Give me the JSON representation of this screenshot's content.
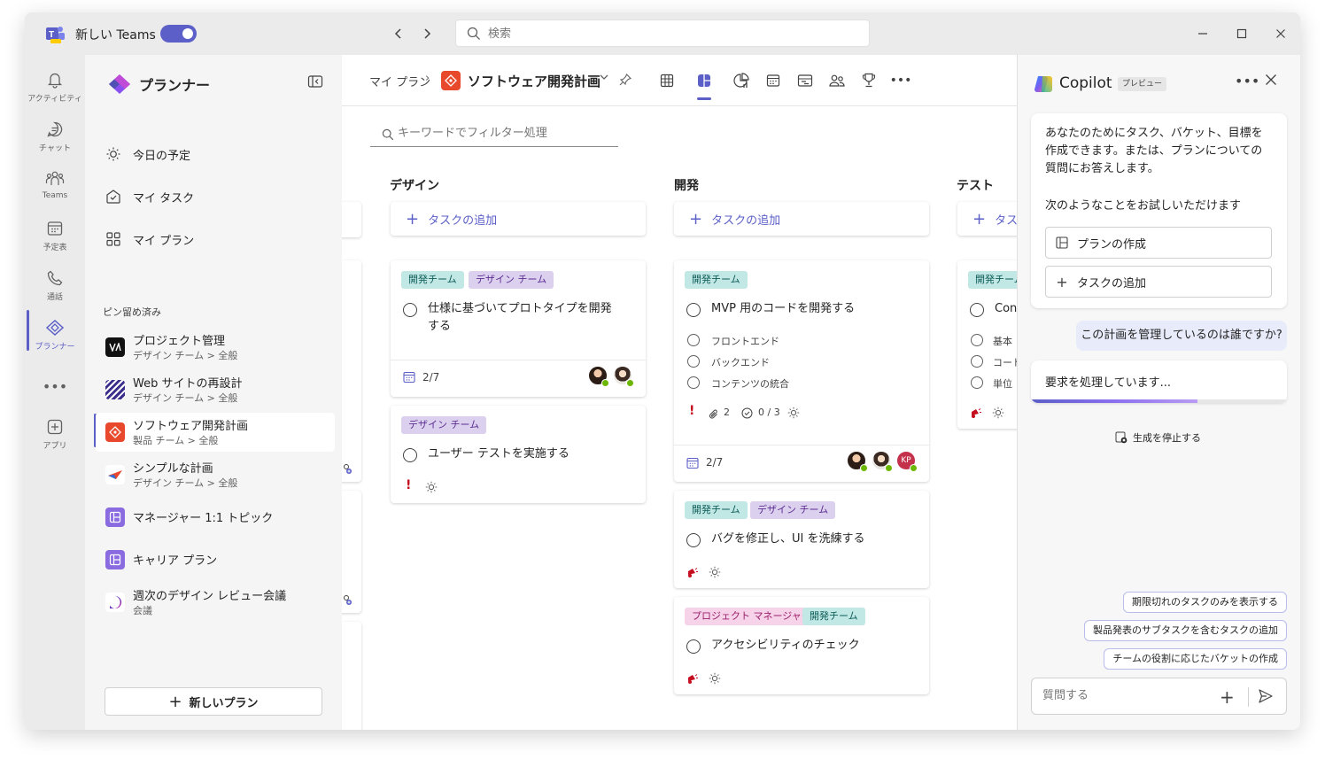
{
  "titlebar": {
    "app_title": "新しい Teams",
    "search_placeholder": "検索"
  },
  "rail": {
    "items": [
      {
        "label": "アクティビティ",
        "icon": "bell-icon"
      },
      {
        "label": "チャット",
        "icon": "chat-icon"
      },
      {
        "label": "Teams",
        "icon": "teams-icon"
      },
      {
        "label": "予定表",
        "icon": "calendar-icon"
      },
      {
        "label": "通話",
        "icon": "phone-icon"
      },
      {
        "label": "プランナー",
        "icon": "planner-icon"
      },
      {
        "label": "アプリ",
        "icon": "apps-icon"
      }
    ]
  },
  "sidebar": {
    "title": "プランナー",
    "nav": [
      {
        "label": "今日の予定",
        "icon": "sun-icon"
      },
      {
        "label": "マイ タスク",
        "icon": "my-tasks-icon"
      },
      {
        "label": "マイ プラン",
        "icon": "grid-icon"
      }
    ],
    "pinned_header": "ピン留め済み",
    "pinned": [
      {
        "title": "プロジェクト管理",
        "subtitle": "デザイン チーム > 全般"
      },
      {
        "title": "Web サイトの再設計",
        "subtitle": "デザイン チーム > 全般"
      },
      {
        "title": "ソフトウェア開発計画",
        "subtitle": "製品 チーム > 全般"
      },
      {
        "title": "シンプルな計画",
        "subtitle": "デザイン チーム > 全般"
      },
      {
        "title": "マネージャー 1:1 トピック",
        "subtitle": ""
      },
      {
        "title": "キャリア プラン",
        "subtitle": ""
      },
      {
        "title": "週次のデザイン レビュー会議",
        "subtitle": "会議"
      }
    ],
    "new_plan_label": "新しいプラン"
  },
  "main": {
    "breadcrumb_root": "マイ プラン",
    "plan_title": "ソフトウェア開発計画",
    "filter_placeholder": "キーワードでフィルター処理",
    "add_task_label": "タスクの追加",
    "buckets": [
      {
        "title": "デザイン",
        "cards": [
          {
            "tags": [
              "開発チーム",
              "デザイン チーム"
            ],
            "title": [
              "仕様に基づいてプロトタイプを開発",
              "する"
            ],
            "date": "2/7"
          },
          {
            "tags": [
              "デザイン チーム"
            ],
            "title": [
              "ユーザー テストを実施する"
            ]
          }
        ]
      },
      {
        "title": "開発",
        "cards": [
          {
            "tags": [
              "開発チーム"
            ],
            "title": [
              "MVP 用のコードを開発する"
            ],
            "subtasks": [
              "フロントエンド",
              "バックエンド",
              "コンテンツの統合"
            ],
            "attachments": "2",
            "checklist": "0 / 3",
            "date": "2/7",
            "avatar_initials": "KP"
          },
          {
            "tags": [
              "開発チーム",
              "デザイン チーム"
            ],
            "title": [
              "バグを修正し、UI を洗練する"
            ]
          },
          {
            "tags": [
              "プロジェクト マネージャー",
              "開発チーム"
            ],
            "title": [
              "アクセシビリティのチェック"
            ]
          }
        ]
      },
      {
        "title": "テスト",
        "cards": [
          {
            "tags": [
              "開発チーム"
            ],
            "title": [
              "Con"
            ],
            "subtasks": [
              "基本",
              "コード",
              "単位"
            ]
          }
        ]
      }
    ]
  },
  "copilot": {
    "title": "Copilot",
    "badge": "プレビュー",
    "intro": "あなたのためにタスク、バケット、目標を作成できます。または、プランについての質問にお答えします。",
    "try_label": "次のようなことをお試しいただけます",
    "actions": [
      {
        "label": "プランの作成",
        "icon": "plan-icon"
      },
      {
        "label": "タスクの追加",
        "icon": "plus-icon"
      }
    ],
    "user_message": "この計画を管理しているのは誰ですか?",
    "processing": "要求を処理しています...",
    "progress": 0.65,
    "stop_label": "生成を停止する",
    "suggestions": [
      "期限切れのタスクのみを表示する",
      "製品発表のサブタスクを含むタスクの追加",
      "チームの役割に応じたバケットの作成"
    ],
    "input_placeholder": "質問する"
  }
}
